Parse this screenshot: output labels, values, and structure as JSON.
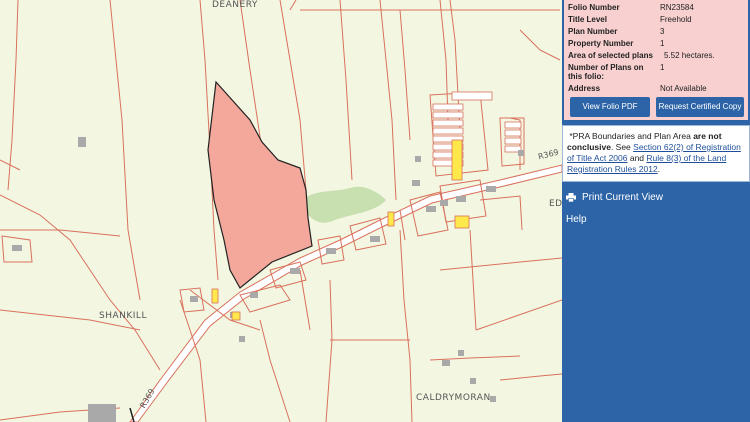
{
  "map": {
    "place_labels": {
      "deanery": "DEANERY",
      "shankill": "SHANKILL",
      "caldrymoran": "CALDRYMORAN",
      "ed": "ED"
    },
    "road_labels": {
      "r369_east": "R369",
      "r369_west": "R369"
    },
    "colors": {
      "background": "#f3f7e2",
      "boundary": "#d9705c",
      "selected_fill": "#f4a79b",
      "selected_outline": "#222222",
      "road_fill": "#ffffff",
      "building": "#a9a9a9",
      "highlight": "#ffe84a",
      "wooded": "#c8e0b0"
    }
  },
  "info_panel": {
    "rows": [
      {
        "label": "Folio Number",
        "value": "RN23584"
      },
      {
        "label": "Title Level",
        "value": "Freehold"
      },
      {
        "label": "Plan Number",
        "value": "3"
      },
      {
        "label": "Property Number",
        "value": "1"
      },
      {
        "label": "Area of selected plans",
        "value": "5.52 hectares."
      },
      {
        "label": "Number of Plans on this folio:",
        "value": "1"
      },
      {
        "label": "Address",
        "value": "Not Available"
      }
    ],
    "view_pdf_button": "View Folio PDF",
    "request_copy_button": "Request Certified Copy"
  },
  "notice": {
    "prefix": "*PRA Boundaries and Plan Area ",
    "bold": "are not conclusive",
    "middle": ". See ",
    "link1": "Section 62(2) of Registration of Title Act 2006",
    "and": " and ",
    "link2": "Rule 8(3) of the Land Registration Rules 2012",
    "suffix": "."
  },
  "menu": {
    "print_label": "Print Current View",
    "help_label": "Help"
  }
}
